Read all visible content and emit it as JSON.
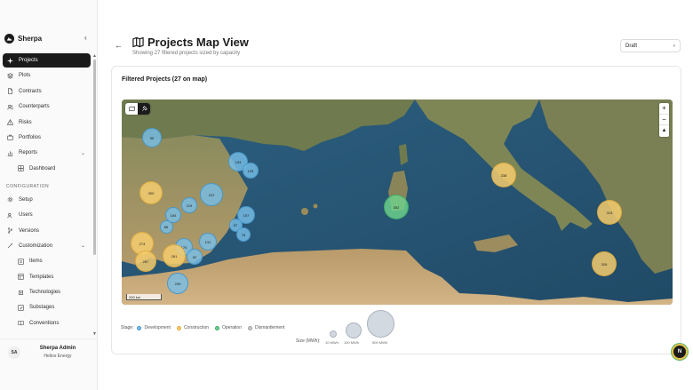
{
  "app": {
    "name": "Sherpa",
    "collapse_icon": "chevron-left-icon"
  },
  "nav": {
    "items": [
      {
        "label": "Projects",
        "icon": "target-icon",
        "active": true
      },
      {
        "label": "Plots",
        "icon": "layers-icon"
      },
      {
        "label": "Contracts",
        "icon": "file-icon"
      },
      {
        "label": "Counterparts",
        "icon": "users-icon"
      },
      {
        "label": "Risks",
        "icon": "alert-icon"
      },
      {
        "label": "Portfolios",
        "icon": "briefcase-icon"
      },
      {
        "label": "Reports",
        "icon": "chart-icon",
        "expandable": true
      }
    ],
    "reports_sub": [
      {
        "label": "Dashboard",
        "icon": "grid-icon"
      }
    ],
    "config_label": "CONFIGURATION",
    "config_items": [
      {
        "label": "Setup",
        "icon": "gear-icon"
      },
      {
        "label": "Users",
        "icon": "users-icon"
      },
      {
        "label": "Versions",
        "icon": "branch-icon"
      },
      {
        "label": "Customization",
        "icon": "wand-icon",
        "expandable": true
      }
    ],
    "customization_sub": [
      {
        "label": "Items",
        "icon": "list-icon"
      },
      {
        "label": "Templates",
        "icon": "template-icon"
      },
      {
        "label": "Technologies",
        "icon": "cpu-icon"
      },
      {
        "label": "Substages",
        "icon": "steps-icon"
      },
      {
        "label": "Conventions",
        "icon": "book-icon"
      }
    ]
  },
  "user": {
    "initials": "SA",
    "name": "Sherpa Admin",
    "org": "Helios Energy"
  },
  "header": {
    "title": "Projects Map View",
    "subtitle": "Showing 27 filtered projects sized by capacity",
    "status_value": "Draft"
  },
  "card": {
    "title": "Filtered Projects (27 on map)"
  },
  "map": {
    "scale_label": "200 km",
    "zoom_in": "+",
    "zoom_out": "−",
    "reset": "▲",
    "bubbles": [
      {
        "label": "95",
        "stage": "development"
      },
      {
        "label": "183",
        "stage": "development"
      },
      {
        "label": "105",
        "stage": "development"
      },
      {
        "label": "300",
        "stage": "construction"
      },
      {
        "label": "222",
        "stage": "development"
      },
      {
        "label": "119",
        "stage": "development"
      },
      {
        "label": "184",
        "stage": "development"
      },
      {
        "label": "86",
        "stage": "development"
      },
      {
        "label": "157",
        "stage": "development"
      },
      {
        "label": "57",
        "stage": "development"
      },
      {
        "label": "78",
        "stage": "development"
      },
      {
        "label": "274",
        "stage": "construction"
      },
      {
        "label": "170",
        "stage": "development"
      },
      {
        "label": "131",
        "stage": "development"
      },
      {
        "label": "287",
        "stage": "construction"
      },
      {
        "label": "261",
        "stage": "construction"
      },
      {
        "label": "92",
        "stage": "development"
      },
      {
        "label": "209",
        "stage": "development"
      },
      {
        "label": "352",
        "stage": "operation"
      },
      {
        "label": "338",
        "stage": "construction"
      },
      {
        "label": "313",
        "stage": "construction"
      },
      {
        "label": "326",
        "stage": "construction"
      }
    ]
  },
  "legend": {
    "stage_label": "Stage:",
    "stages": [
      {
        "label": "Development",
        "color": "#78bee6"
      },
      {
        "label": "Construction",
        "color": "#f5cd6e"
      },
      {
        "label": "Operation",
        "color": "#6ed28c"
      },
      {
        "label": "Dismantlement",
        "color": "#c8c8c8"
      }
    ],
    "size_label": "Size (MWh):",
    "sizes": [
      "10 MWh",
      "100 MWh",
      "500 MWh"
    ]
  },
  "fab_label": "N"
}
